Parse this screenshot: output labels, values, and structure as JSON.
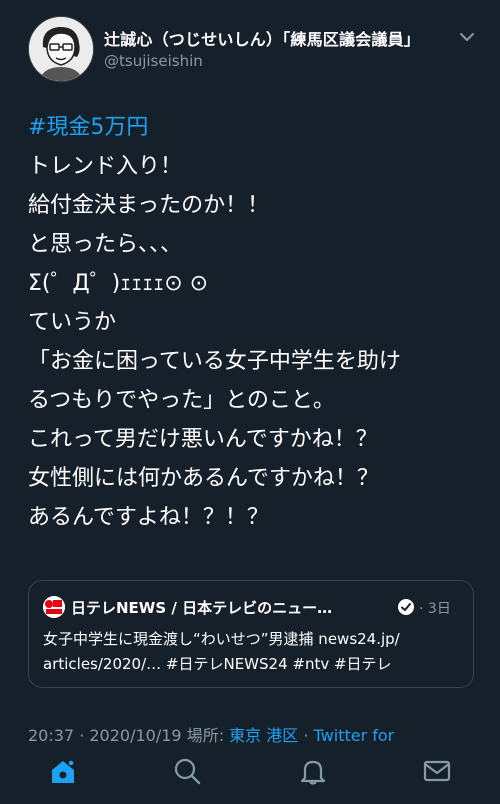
{
  "author": {
    "name": "辻誠心（つじせいしん）「練馬区議会議員」",
    "handle": "@tsujiseishin"
  },
  "tweet": {
    "lines": [
      {
        "text": "#現金5万円",
        "hashtag": true
      },
      {
        "text": "トレンド入り！",
        "hashtag": false
      },
      {
        "text": "給付金決まったのか！！",
        "hashtag": false
      },
      {
        "text": "と思ったら、、、",
        "hashtag": false
      },
      {
        "text": "Σ(゜Д゜)ｪｪｪｪ⊙ ⊙",
        "hashtag": false
      },
      {
        "text": "ていうか",
        "hashtag": false
      },
      {
        "text": "「お金に困っている女子中学生を助け",
        "hashtag": false
      },
      {
        "text": "るつもりでやった」とのこと。",
        "hashtag": false
      },
      {
        "text": "これって男だけ悪いんですかね！？",
        "hashtag": false
      },
      {
        "text": "女性側には何かあるんですかね！？",
        "hashtag": false
      },
      {
        "text": "あるんですよね！？！？",
        "hashtag": false
      }
    ]
  },
  "card": {
    "logo_text": "日テレ NEWS",
    "title": "日テレNEWS / 日本テレビのニュー…",
    "separator": "·",
    "time": "3日",
    "body_lines": [
      "女子中学生に現金渡し“わいせつ”男逮捕 news24.jp/",
      "articles/2020/… #日テレNEWS24 #ntv #日テレ"
    ]
  },
  "meta": {
    "time_date": "20:37 · 2020/10/19",
    "place_label": "場所: ",
    "place": "東京 港区",
    "sep": " · ",
    "source": "Twitter for"
  },
  "colors": {
    "background": "#15202b",
    "accent": "#1da1f2",
    "muted": "#8899a6",
    "border": "#38444d"
  },
  "icons": {
    "tabs": [
      "home-icon",
      "search-icon",
      "notifications-icon",
      "messages-icon"
    ]
  }
}
